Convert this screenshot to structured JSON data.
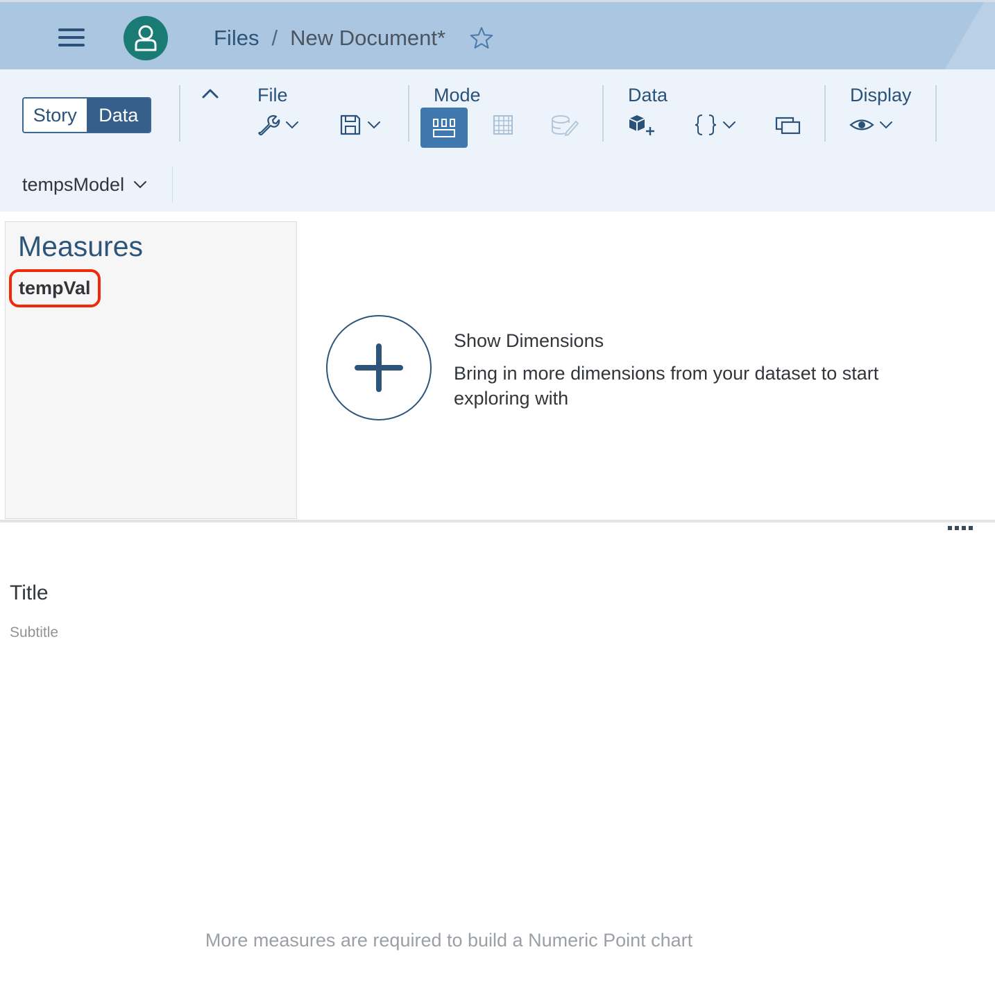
{
  "shell": {
    "breadcrumb_root": "Files",
    "breadcrumb_separator": "/",
    "document_title": "New Document*",
    "avatar_color": "#1a7b75"
  },
  "toolbar": {
    "story_label": "Story",
    "data_label": "Data",
    "active_view": "Data",
    "groups": {
      "file": "File",
      "mode": "Mode",
      "data": "Data",
      "display": "Display"
    },
    "model_name": "tempsModel"
  },
  "measures": {
    "heading": "Measures",
    "items": [
      "tempVal"
    ]
  },
  "dimensions_prompt": {
    "title": "Show Dimensions",
    "description": "Bring in more dimensions from your dataset to start exploring with"
  },
  "chart": {
    "title": "Title",
    "subtitle": "Subtitle",
    "message": "More measures are required to build a Numeric Point chart"
  },
  "colors": {
    "shell_bg": "#abc6e0",
    "toolbar_bg": "#edf3fa",
    "accent": "#355f8a",
    "highlight": "#ee2a0b"
  }
}
